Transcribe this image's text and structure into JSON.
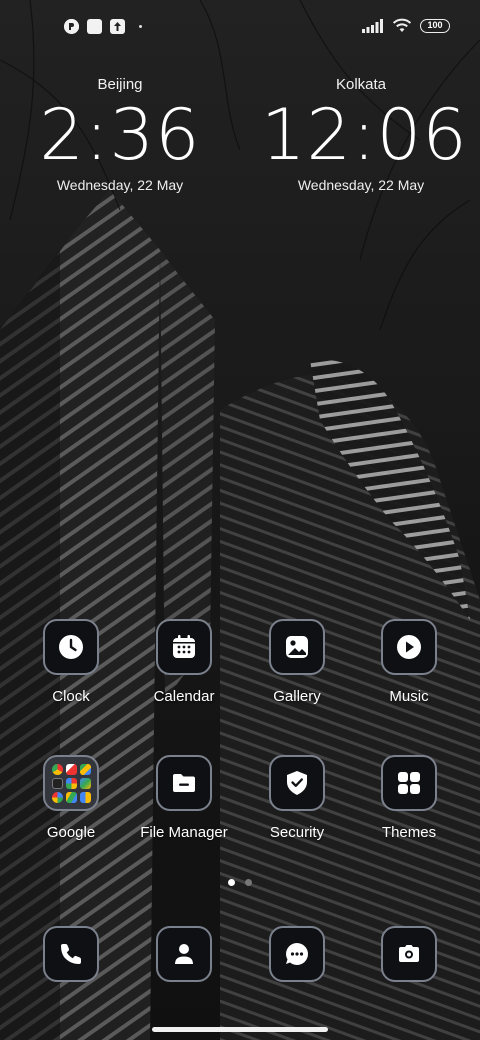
{
  "status_bar": {
    "battery_level": "100",
    "left_icons": [
      "app-notification-icon",
      "white-square-icon",
      "upload-icon",
      "more-dot-icon"
    ],
    "right_icons": [
      "signal-icon",
      "wifi-icon",
      "battery-icon"
    ]
  },
  "clocks": [
    {
      "city": "Beijing",
      "time": "2:36",
      "date": "Wednesday, 22 May"
    },
    {
      "city": "Kolkata",
      "time": "12:06",
      "date": "Wednesday, 22 May"
    }
  ],
  "apps": [
    {
      "label": "Clock",
      "icon": "clock-icon"
    },
    {
      "label": "Calendar",
      "icon": "calendar-icon"
    },
    {
      "label": "Gallery",
      "icon": "gallery-icon"
    },
    {
      "label": "Music",
      "icon": "music-play-icon"
    },
    {
      "label": "Google",
      "icon": "google-folder-icon"
    },
    {
      "label": "File Manager",
      "icon": "folder-icon"
    },
    {
      "label": "Security",
      "icon": "shield-check-icon"
    },
    {
      "label": "Themes",
      "icon": "themes-grid-icon"
    }
  ],
  "dock": [
    {
      "name": "phone",
      "icon": "phone-icon"
    },
    {
      "name": "contacts",
      "icon": "contacts-icon"
    },
    {
      "name": "messages",
      "icon": "message-icon"
    },
    {
      "name": "camera",
      "icon": "camera-icon"
    }
  ],
  "page_indicator": {
    "current": 1,
    "total": 2
  },
  "colors": {
    "tile_bg": "#0e1014",
    "tile_border": "#7b818c",
    "wallpaper": "#1a1a1a"
  }
}
